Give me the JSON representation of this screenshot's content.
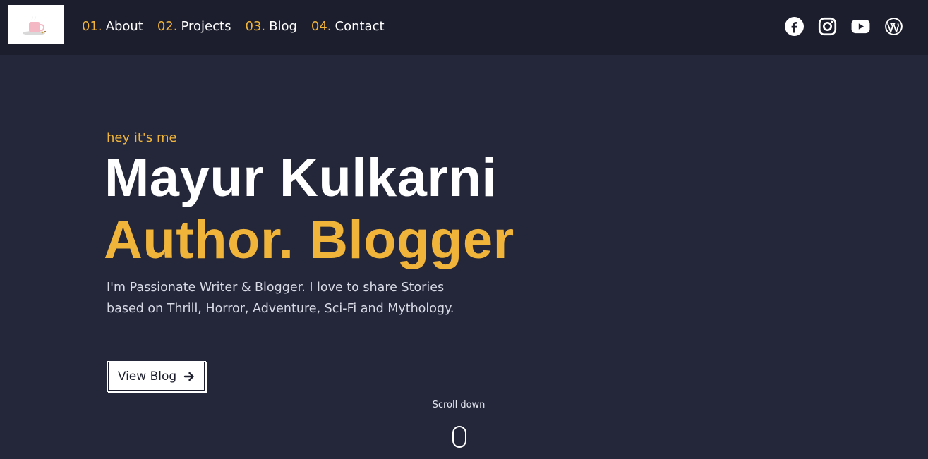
{
  "nav": {
    "logo_icon": "coffee-cup-logo",
    "items": [
      {
        "num": "01.",
        "label": "About"
      },
      {
        "num": "02.",
        "label": "Projects"
      },
      {
        "num": "03.",
        "label": "Blog"
      },
      {
        "num": "04.",
        "label": "Contact"
      }
    ],
    "socials": [
      "facebook-icon",
      "instagram-icon",
      "youtube-icon",
      "wordpress-icon"
    ]
  },
  "hero": {
    "greeting": "hey it's me",
    "name": "Mayur Kulkarni",
    "role": "Author. Blogger",
    "bio": "I'm Passionate Writer & Blogger. I love to share Stories based on Thrill, Horror, Adventure, Sci-Fi and Mythology.",
    "cta_label": "View Blog"
  },
  "scroll": {
    "label": "Scroll down"
  },
  "colors": {
    "background": "#24273a",
    "navbar": "#1c1e2d",
    "accent": "#f0b43a",
    "text": "#ffffff"
  }
}
